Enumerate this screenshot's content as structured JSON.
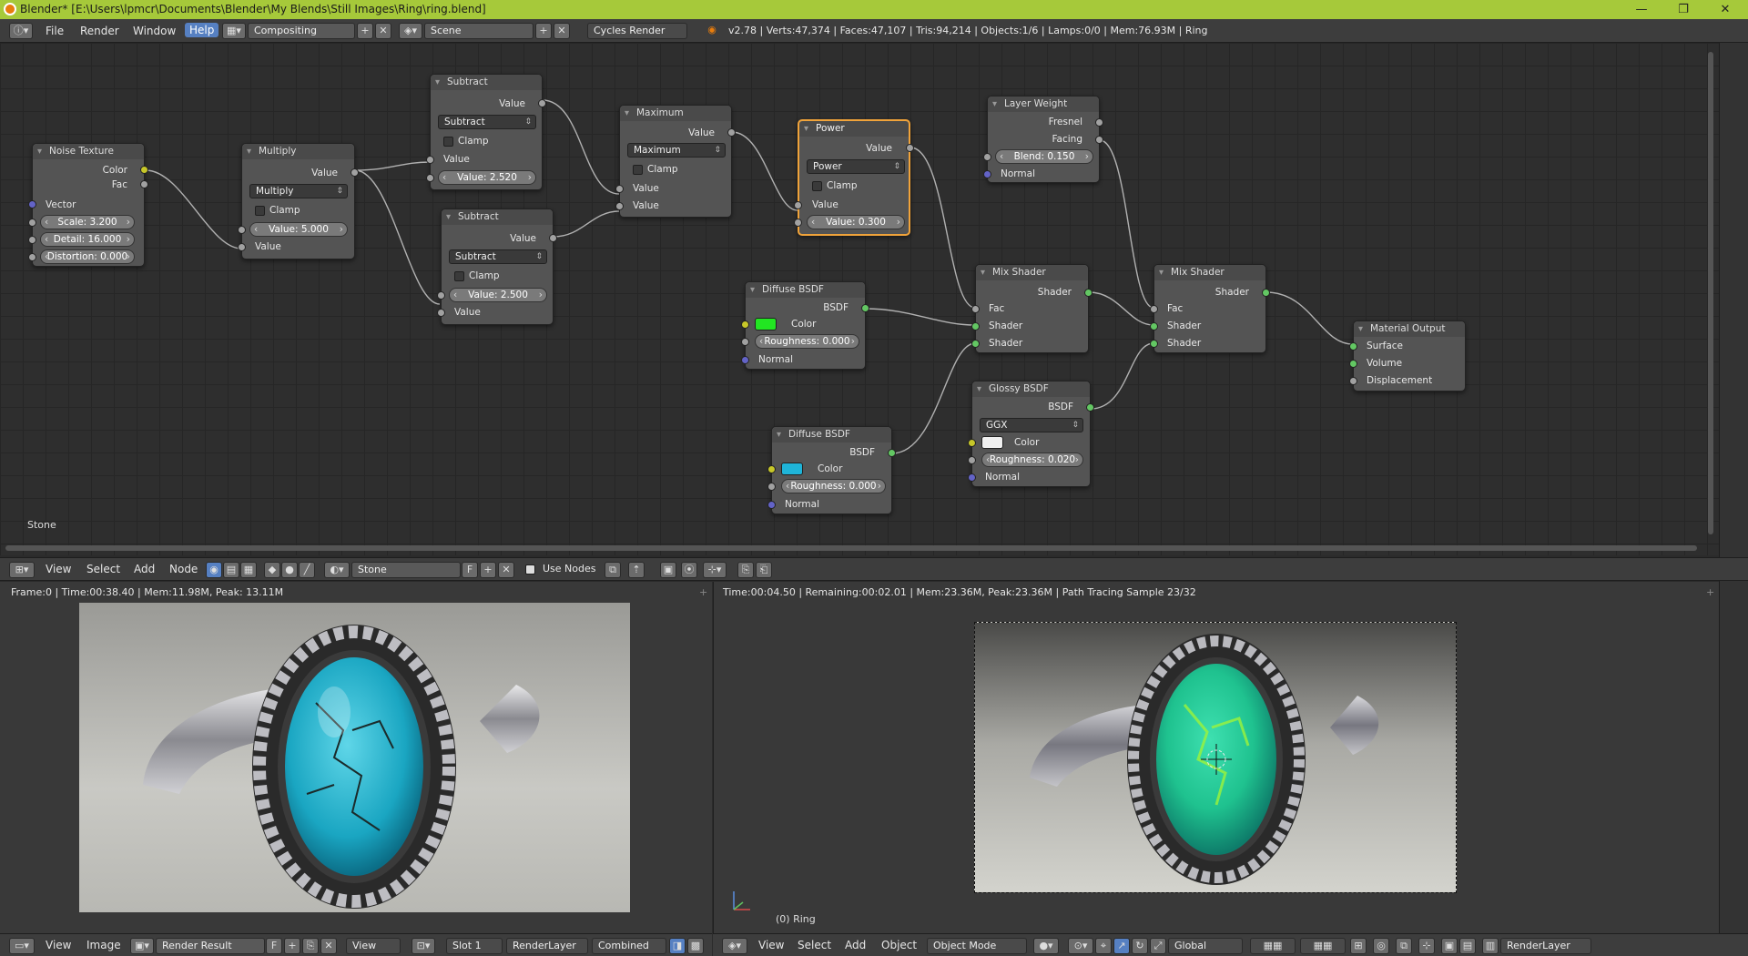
{
  "window": {
    "title": "Blender* [E:\\Users\\lpmcr\\Documents\\Blender\\My Blends\\Still Images\\Ring\\ring.blend]",
    "minimize": "—",
    "maximize": "❐",
    "close": "✕"
  },
  "info_header": {
    "menus": [
      "File",
      "Render",
      "Window",
      "Help"
    ],
    "screen_layout": "Compositing",
    "scene": "Scene",
    "render_engine": "Cycles Render",
    "stats": "v2.78 | Verts:47,374 | Faces:47,107 | Tris:94,214 | Objects:1/6 | Lamps:0/0 | Mem:76.93M | Ring"
  },
  "nodes": {
    "noise": {
      "title": "Noise Texture",
      "out_color": "Color",
      "out_fac": "Fac",
      "in_vector": "Vector",
      "scale": "Scale:",
      "scale_val": "3.200",
      "detail": "Detail:",
      "detail_val": "16.000",
      "distortion": "Distortion:",
      "distortion_val": "0.000"
    },
    "multiply": {
      "title": "Multiply",
      "out": "Value",
      "op": "Multiply",
      "clamp": "Clamp",
      "value_label": "Value:",
      "value": "5.000",
      "in": "Value"
    },
    "subtract1": {
      "title": "Subtract",
      "out": "Value",
      "op": "Subtract",
      "clamp": "Clamp",
      "in": "Value",
      "value_label": "Value:",
      "value": "2.520"
    },
    "subtract2": {
      "title": "Subtract",
      "out": "Value",
      "op": "Subtract",
      "clamp": "Clamp",
      "value_label": "Value:",
      "value": "2.500",
      "in": "Value"
    },
    "maximum": {
      "title": "Maximum",
      "out": "Value",
      "op": "Maximum",
      "clamp": "Clamp",
      "in1": "Value",
      "in2": "Value"
    },
    "power": {
      "title": "Power",
      "out": "Value",
      "op": "Power",
      "clamp": "Clamp",
      "in": "Value",
      "value_label": "Value:",
      "value": "0.300"
    },
    "layerweight": {
      "title": "Layer Weight",
      "out_fresnel": "Fresnel",
      "out_facing": "Facing",
      "blend_label": "Blend:",
      "blend": "0.150",
      "normal": "Normal"
    },
    "diffuse1": {
      "title": "Diffuse BSDF",
      "out": "BSDF",
      "color": "Color",
      "rough_label": "Roughness:",
      "rough": "0.000",
      "normal": "Normal",
      "swatch": "#22e622"
    },
    "diffuse2": {
      "title": "Diffuse BSDF",
      "out": "BSDF",
      "color": "Color",
      "rough_label": "Roughness:",
      "rough": "0.000",
      "normal": "Normal",
      "swatch": "#1fb4d8"
    },
    "mix1": {
      "title": "Mix Shader",
      "out": "Shader",
      "fac": "Fac",
      "sh1": "Shader",
      "sh2": "Shader"
    },
    "mix2": {
      "title": "Mix Shader",
      "out": "Shader",
      "fac": "Fac",
      "sh1": "Shader",
      "sh2": "Shader"
    },
    "glossy": {
      "title": "Glossy BSDF",
      "out": "BSDF",
      "dist": "GGX",
      "color": "Color",
      "rough_label": "Roughness:",
      "rough": "0.020",
      "normal": "Normal",
      "swatch": "#f0f0f0"
    },
    "output": {
      "title": "Material Output",
      "surface": "Surface",
      "volume": "Volume",
      "displacement": "Displacement"
    }
  },
  "node_editor": {
    "material_label": "Stone",
    "menus": [
      "View",
      "Select",
      "Add",
      "Node"
    ],
    "material_name": "Stone",
    "fake_user": "F",
    "use_nodes_label": "Use Nodes"
  },
  "image_editor": {
    "stats": "Frame:0 | Time:00:38.40 | Mem:11.98M, Peak: 13.11M",
    "menus": [
      "View",
      "Image"
    ],
    "image_name": "Render Result",
    "fake_user": "F",
    "view_label": "View",
    "slot": "Slot 1",
    "layer": "RenderLayer",
    "pass": "Combined"
  },
  "viewport": {
    "stats": "Time:00:04.50 | Remaining:00:02.01 | Mem:23.36M, Peak:23.36M | Path Tracing Sample 23/32",
    "object_label": "(0) Ring",
    "menus": [
      "View",
      "Select",
      "Add",
      "Object"
    ],
    "mode": "Object Mode",
    "orientation": "Global",
    "layer": "RenderLayer"
  }
}
